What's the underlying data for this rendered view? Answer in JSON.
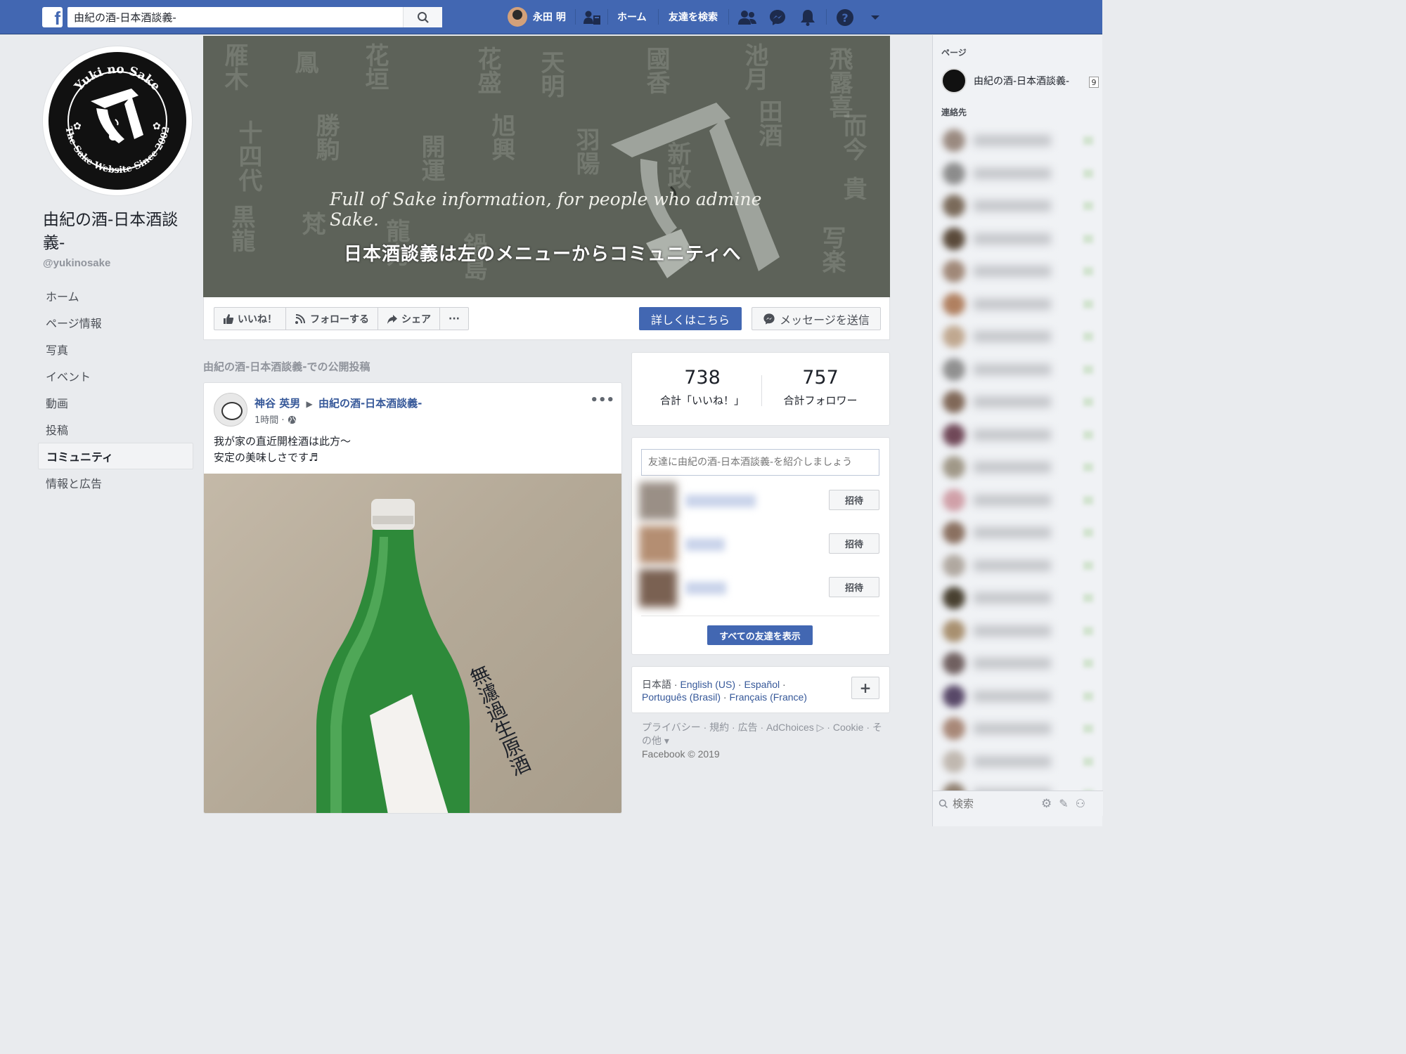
{
  "topbar": {
    "logo": "f",
    "search_value": "由紀の酒-日本酒談義-",
    "user_name": "永田 明",
    "home_label": "ホーム",
    "find_friends_label": "友達を検索"
  },
  "page": {
    "name": "由紀の酒-日本酒談義-",
    "handle": "@yukinosake",
    "nav": [
      {
        "label": "ホーム",
        "active": false
      },
      {
        "label": "ページ情報",
        "active": false
      },
      {
        "label": "写真",
        "active": false
      },
      {
        "label": "イベント",
        "active": false
      },
      {
        "label": "動画",
        "active": false
      },
      {
        "label": "投稿",
        "active": false
      },
      {
        "label": "コミュニティ",
        "active": true
      },
      {
        "label": "情報と広告",
        "active": false
      }
    ]
  },
  "cover": {
    "logo_top_text": "Yuki no Sake",
    "logo_bottom_text": "The Sake Website Since 2002",
    "tagline": "Full of Sake information, for people who admine Sake.",
    "banner": "日本酒談義は左のメニューからコミュニティへ",
    "kanji": [
      "雁木",
      "鳳",
      "花垣",
      "花盛",
      "天明",
      "國香",
      "池月",
      "飛露喜",
      "十四代",
      "勝駒",
      "開運",
      "旭興",
      "羽陽",
      "新政",
      "田酒",
      "而今",
      "黒龍",
      "梵",
      "龍力",
      "鍋島",
      "写楽",
      "貴"
    ]
  },
  "actions": {
    "like": "いいね！",
    "follow": "フォローする",
    "share": "シェア",
    "more": "···",
    "learn_more": "詳しくはこちら",
    "send_message": "メッセージを送信"
  },
  "posts_section_title": "由紀の酒-日本酒談義-での公開投稿",
  "post": {
    "author": "神谷 英男",
    "target": "由紀の酒-日本酒談義-",
    "time": "1時間 · ",
    "line1": "我が家の直近開栓酒は此方～",
    "line2": "安定の美味しさです♬",
    "label_text": "無濾過生原酒"
  },
  "stats": {
    "likes": "738",
    "likes_label": "合計「いいね！」",
    "followers": "757",
    "followers_label": "合計フォロワー"
  },
  "invite": {
    "placeholder": "友達に由紀の酒-日本酒談義-を紹介しましょう",
    "button": "招待",
    "see_all": "すべての友達を表示"
  },
  "languages": {
    "current": "日本語",
    "list": [
      "English (US)",
      "Español",
      "Português (Brasil)",
      "Français (France)"
    ],
    "add": "+"
  },
  "footer": {
    "links": "プライバシー · 規約 · 広告 · AdChoices ▷ · Cookie · その他 ▾",
    "copyright": "Facebook © 2019"
  },
  "sidebar": {
    "pages_label": "ページ",
    "page_name": "由紀の酒-日本酒談義-",
    "badge": "9",
    "contacts_label": "連絡先",
    "search_placeholder": "検索",
    "avatar_colors": [
      "#9a8a80",
      "#8c8c8c",
      "#7a6a5a",
      "#5a4a3a",
      "#a08878",
      "#b08060",
      "#c0a890",
      "#909090",
      "#806858",
      "#704858",
      "#a09888",
      "#d0a0a8",
      "#8a7060",
      "#b0a8a0",
      "#484030",
      "#a89070",
      "#706060",
      "#584868",
      "#a88878",
      "#c0b8b0",
      "#908070"
    ]
  }
}
